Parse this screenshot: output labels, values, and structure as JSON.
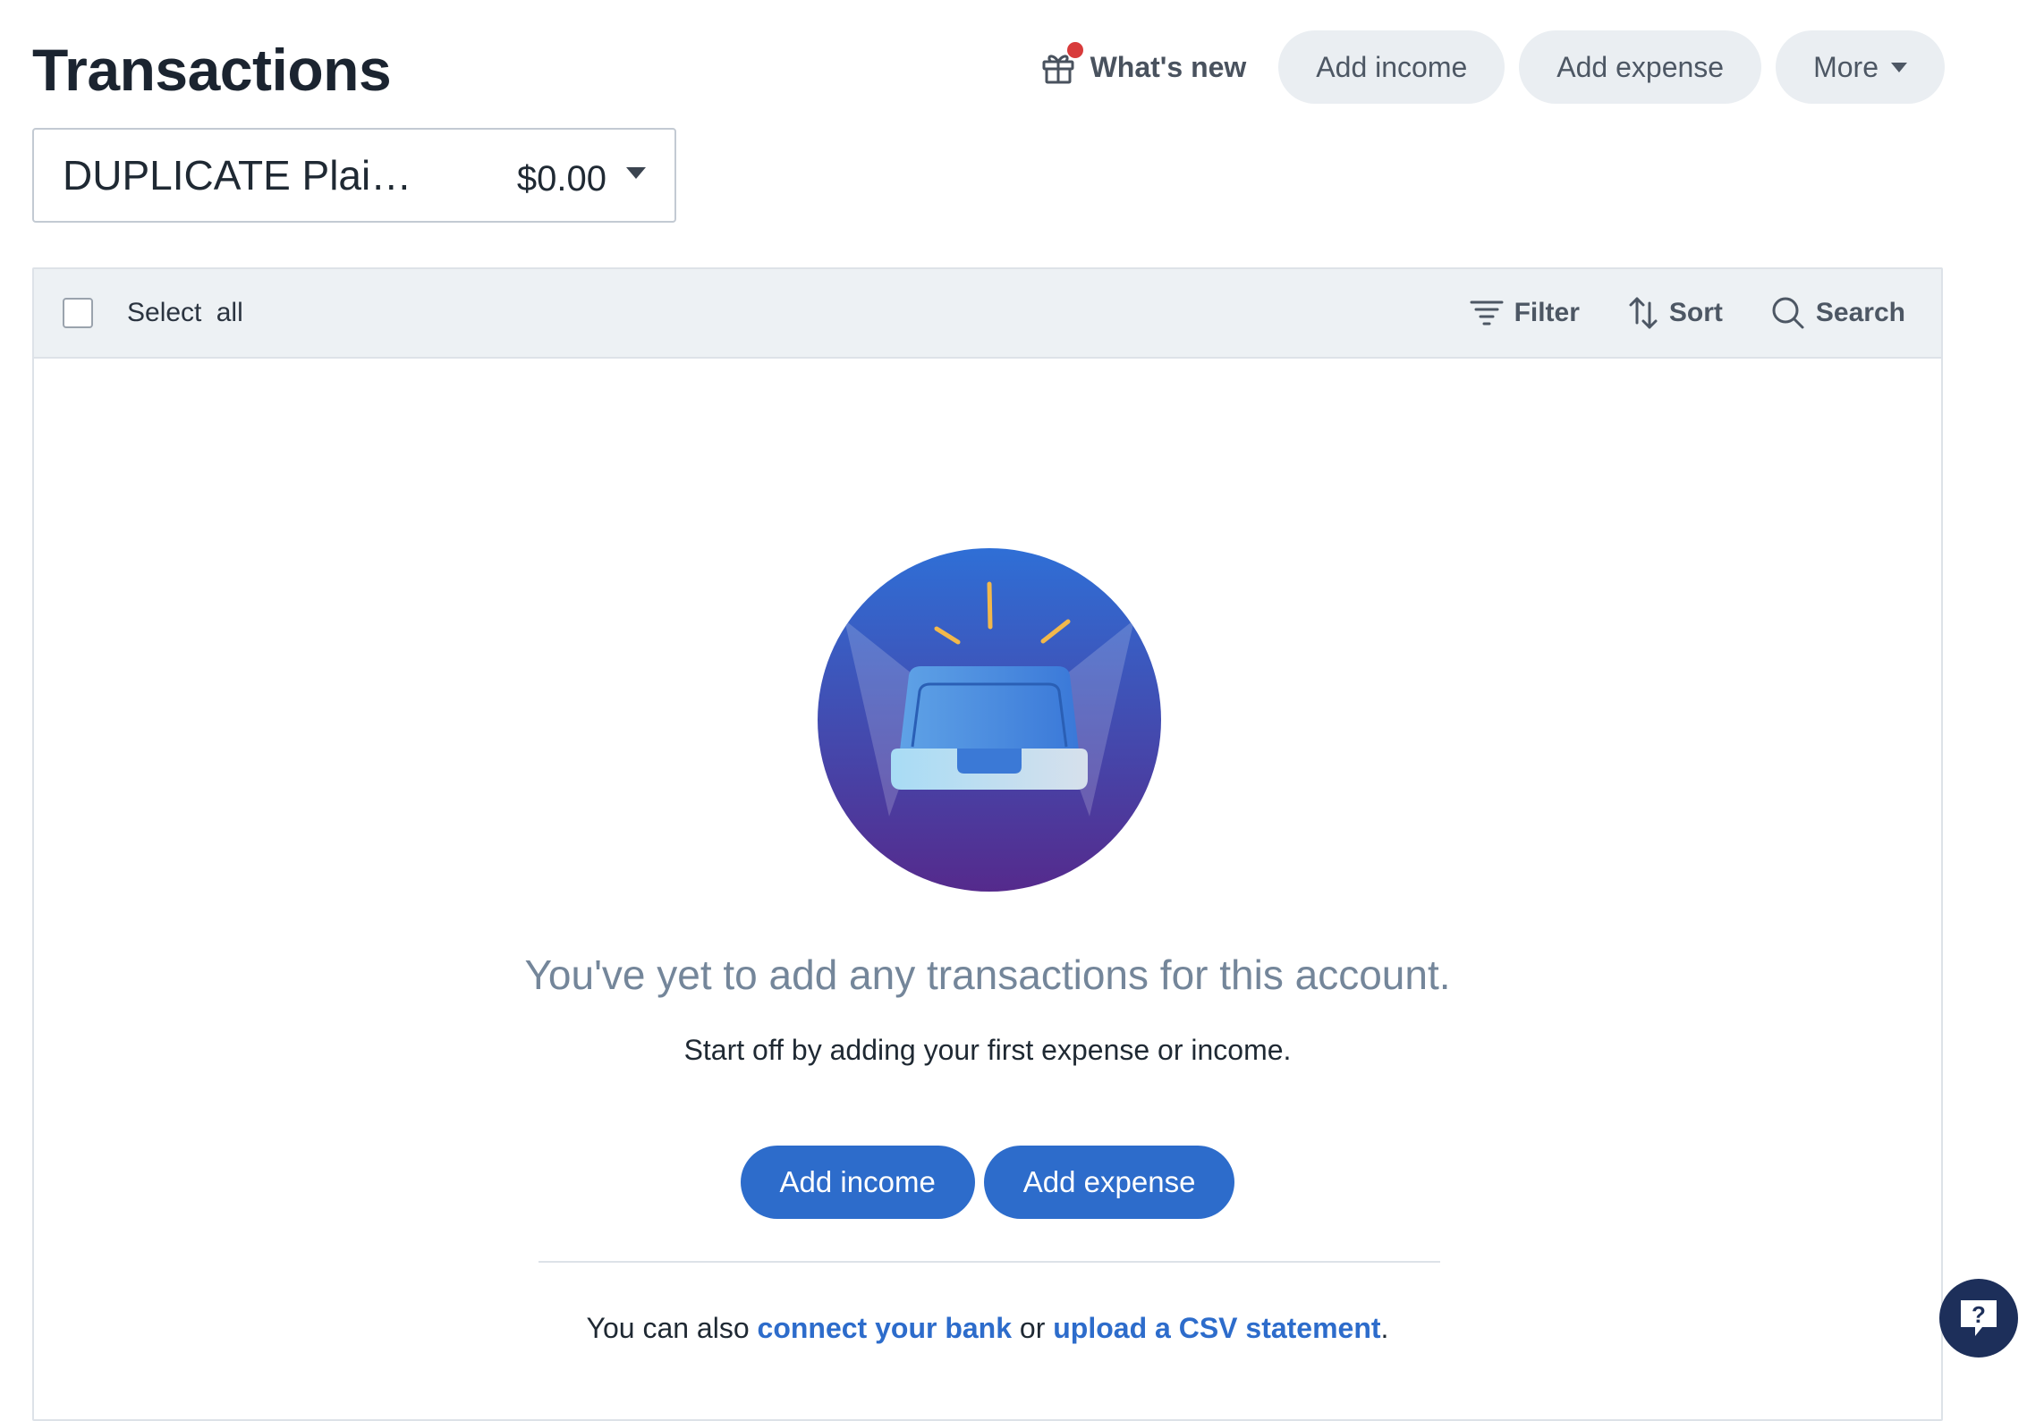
{
  "header": {
    "title": "Transactions",
    "whats_new_label": "What's new",
    "add_income_label": "Add income",
    "add_expense_label": "Add expense",
    "more_label": "More"
  },
  "account": {
    "name": "DUPLICATE Plai…",
    "balance": "$0.00"
  },
  "toolbar": {
    "select_all_label": "Select  all",
    "filter_label": "Filter",
    "sort_label": "Sort",
    "search_label": "Search"
  },
  "empty_state": {
    "title": "You've yet to add any transactions for this account.",
    "subtitle": "Start off by adding your first expense or income.",
    "add_income_label": "Add income",
    "add_expense_label": "Add expense",
    "footer_prefix": "You can also ",
    "connect_bank_label": "connect your bank",
    "footer_middle": " or ",
    "upload_csv_label": "upload a CSV statement",
    "footer_suffix": "."
  },
  "colors": {
    "primary": "#2d6ccb",
    "notification_dot": "#d83b3b",
    "help_fab": "#1d2f5a"
  },
  "icons": {
    "whats_new": "gift-icon",
    "filter": "filter-icon",
    "sort": "sort-icon",
    "search": "search-icon",
    "help": "help-icon"
  }
}
